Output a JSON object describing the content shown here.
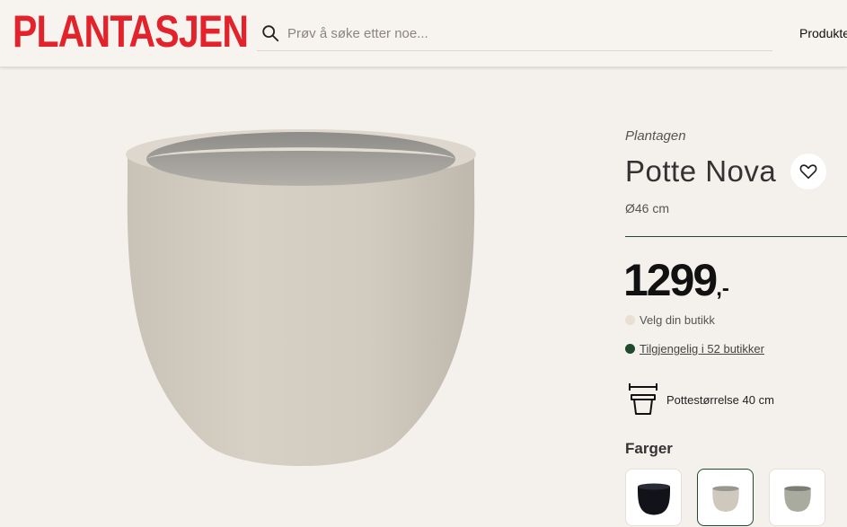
{
  "header": {
    "logo": "PLANTASJEN",
    "search_placeholder": "Prøv å søke etter noe...",
    "nav_products": "Produkter"
  },
  "product": {
    "brand": "Plantagen",
    "title": "Potte Nova",
    "size": "Ø46 cm",
    "price": "1299",
    "price_suffix": ",-",
    "store_prompt": "Velg din butikk",
    "availability": "Tilgjengelig i 52 butikker",
    "pot_size": "Pottestørrelse 40 cm",
    "colors_heading": "Farger",
    "colors": [
      "black",
      "beige",
      "grey-green"
    ],
    "selected_color": "beige"
  },
  "icons": {
    "search": "search-icon",
    "favorite": "heart-icon",
    "pot_size": "pot-size-icon"
  },
  "colors_hex": {
    "brand_red": "#e3232b",
    "accent_green": "#1f4a2e",
    "background": "#f4f0ec"
  }
}
